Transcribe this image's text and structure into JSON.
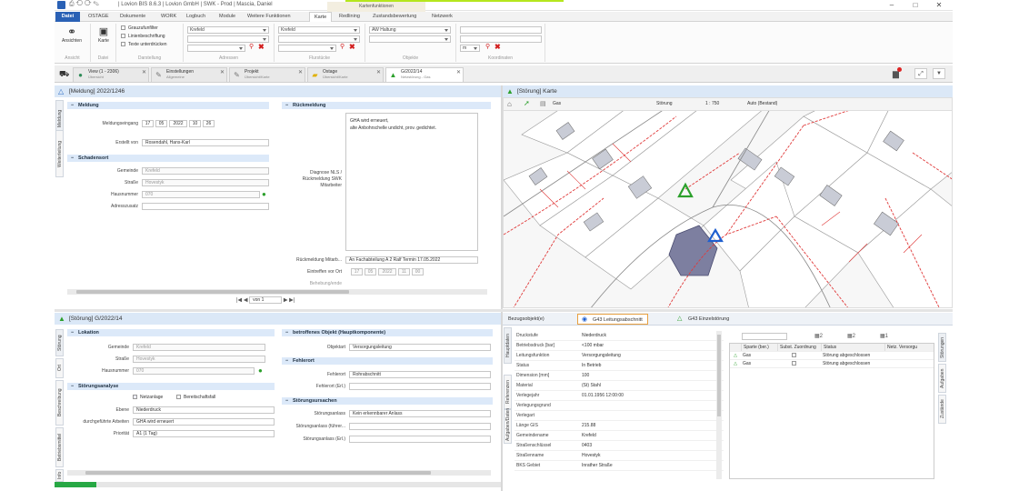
{
  "window": {
    "title": "| Lovion BIS 8.6.3 | Lovion GmbH | SWK - Prod | Mascia, Daniel",
    "context_header": "Kartenfunktionen"
  },
  "ribbon_tabs": [
    {
      "label": "Datei"
    },
    {
      "label": "OSTAGE"
    },
    {
      "label": "Dokumente"
    },
    {
      "label": "WORK"
    },
    {
      "label": "Logbuch"
    },
    {
      "label": "Module"
    },
    {
      "label": "Weitere Funktionen"
    },
    {
      "label": "Karte"
    },
    {
      "label": "Redlining"
    },
    {
      "label": "Zustandsbewertung"
    },
    {
      "label": "Netzwerk"
    }
  ],
  "ribbon": {
    "ansicht": {
      "btn1": "Ansichten",
      "btn2": "Karte",
      "group": "Ansicht",
      "group2": "Datei"
    },
    "darstellung": {
      "opt1": "Grauzufunfilter",
      "opt2": "Linienbeschriftung",
      "opt3": "Texte unterdrücken",
      "group": "Darstellung"
    },
    "adressen": {
      "value": "Krefeld",
      "group": "Adressen"
    },
    "flurstueck": {
      "value": "Krefeld",
      "group": "Flurstücke"
    },
    "objekte": {
      "value": "AW Haltung",
      "group": "Objekte"
    },
    "koordinaten": {
      "value": "m",
      "group": "Koordinaten"
    }
  },
  "doc_tabs": [
    {
      "label": "View (1 - 2306)",
      "sub": "Übersicht"
    },
    {
      "label": "Einstellungen",
      "sub": "Allgemeine"
    },
    {
      "label": "Projekt",
      "sub": "Übersicht/Karte"
    },
    {
      "label": "Ostage",
      "sub": "Übersicht/Karte"
    },
    {
      "label": "G/2022/14",
      "sub": "Netzstörung - Gas"
    }
  ],
  "meldung_panel": {
    "header": "[Meldung] 2022/1246",
    "vtabs": [
      "Meldung",
      "Weiterleitung"
    ],
    "meldung": {
      "section": "Meldung",
      "eingang_label": "Meldungseingang",
      "eingang_date": [
        "17",
        "05",
        "2022"
      ],
      "eingang_time": [
        "10",
        "26"
      ],
      "erstellt_label": "Erstellt von",
      "erstellt_value": "Rosendahl, Hans-Karl"
    },
    "schadensort": {
      "section": "Schadensort",
      "gemeinde_label": "Gemeinde",
      "gemeinde_value": "Krefeld",
      "strasse_label": "Straße",
      "strasse_value": "Hovestyk",
      "hausnummer_label": "Hausnummer",
      "hausnummer_value": "070",
      "adresszusatz_label": "Adresszusatz"
    },
    "rueckmeldung": {
      "section": "Rückmeldung",
      "text_line1": "GHA wird erneuert,",
      "text_line2": "alte Anbohrschelle undicht, prov. gedichtet.",
      "diagnose_label1": "Diagnose NLS /",
      "diagnose_label2": "Rückmeldung SWK",
      "diagnose_label3": "Mitarbeiter",
      "mitarb_label": "Rückmeldung Mitarb...",
      "mitarb_value": "An Fachabteilung A 2 Ralf Termin 17.05.2022",
      "eintreffen_label": "Eintreffen vor Ort",
      "eintreffen_date": [
        "17",
        "05",
        "2022"
      ],
      "eintreffen_time": [
        "11",
        "00"
      ],
      "behebung_label": "Behebung/ende"
    },
    "pager": {
      "label": "von 1"
    }
  },
  "map_panel": {
    "header": "[Störung] Karte",
    "toolbar": {
      "sparte": "Gas",
      "layer": "Störung",
      "scale": "1 : 750",
      "mode": "Auto (Bestand)"
    }
  },
  "stoerung_panel": {
    "header": "[Störung] G/2022/14",
    "vtabs": [
      "Störung",
      "Ort",
      "Beschreibung",
      "Betriebsmittel",
      "Info"
    ],
    "lokation": {
      "section": "Lokation",
      "gemeinde_label": "Gemeinde",
      "gemeinde_value": "Krefeld",
      "strasse_label": "Straße",
      "strasse_value": "Hovestyk",
      "hausnummer_label": "Hausnummer",
      "hausnummer_value": "070"
    },
    "analyse": {
      "section": "Störungsanalyse",
      "chk1": "Netzanlage",
      "chk2": "Bereitschaftsfall",
      "ebene_label": "Ebene",
      "ebene_value": "Niederdruck",
      "arbeiten_label": "durchgeführte Arbeiten",
      "arbeiten_value": "GHA wird erneuert",
      "prioritaet_label": "Priorität",
      "prioritaet_value": "A1 (1 Tag)"
    },
    "objekt": {
      "section": "betroffenes Objekt (Hauptkomponente)",
      "objektart_label": "Objektart",
      "objektart_value": "Versorgungsleitung"
    },
    "fehlerort": {
      "section": "Fehlerort",
      "fehlerort_label": "Fehlerort",
      "fehlerort_value": "Rohrabschnitt",
      "fehlerort_erg_label": "Fehlerort (Erl.)"
    },
    "ursachen": {
      "section": "Störungsursachen",
      "anlass_label": "Störungsanlass",
      "anlass_value": "Kein erkennbarer Anlass",
      "anlass_fuehrer_label": "Störungsanlass (führer...",
      "anlass_erg_label": "Störungsanlass (Erl.)"
    }
  },
  "bezugs_panel": {
    "label": "Bezugsobjekt(e)",
    "tab1": "G43 Leitungsabschnitt",
    "tab2": "G43 Einzelstörung",
    "vtabs_left": [
      "Hauptdaten",
      "Referenzen",
      "Aufgaben/Daten"
    ],
    "vtabs_right": [
      "Störungen",
      "Aufgaben",
      "Zustände"
    ],
    "properties": [
      {
        "key": "Druckstufe",
        "value": "Niederdruck"
      },
      {
        "key": "Betriebsdruck [bar]",
        "value": "<100 mbar"
      },
      {
        "key": "Leitungsfunktion",
        "value": "Versorgungsleitung"
      },
      {
        "key": "Status",
        "value": "In Betrieb"
      },
      {
        "key": "Dimension [mm]",
        "value": "100"
      },
      {
        "key": "Material",
        "value": "(St) Stahl"
      },
      {
        "key": "Verlegejahr",
        "value": "01.01.1956 12:00:00"
      },
      {
        "key": "Verlegungsgrund",
        "value": ""
      },
      {
        "key": "Verlegart",
        "value": ""
      },
      {
        "key": "Länge GIS",
        "value": "215.88"
      },
      {
        "key": "Gemeindename",
        "value": "Krefeld"
      },
      {
        "key": "Straßenschlüssel",
        "value": "0403"
      },
      {
        "key": "Straßenname",
        "value": "Hovestyk"
      },
      {
        "key": "BKS Gebiet",
        "value": "Inrather Straße"
      }
    ],
    "grid": {
      "toolbar_counts": [
        "2",
        "2",
        "1"
      ],
      "columns": [
        "Sparte (ber.)",
        "Subst. Zuordnung",
        "Status",
        "Netz. Versorgu"
      ],
      "rows": [
        {
          "sparte": "Gas",
          "status": "Störung abgeschlossen"
        },
        {
          "sparte": "Gas",
          "status": "Störung abgeschlossen"
        }
      ]
    }
  }
}
